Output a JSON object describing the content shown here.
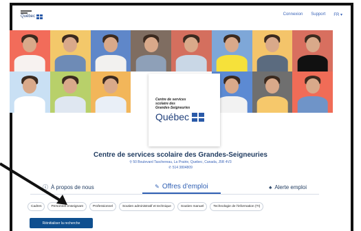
{
  "header": {
    "logo_text": "Québec",
    "links": [
      "Connexion",
      "Support",
      "FR"
    ],
    "colors": {
      "link": "#3a64b8",
      "brand": "#1f3f7a"
    }
  },
  "banner": {
    "tiles": [
      {
        "bg": "#f26c5a",
        "body": "#f7f2f0"
      },
      {
        "bg": "#f3c86a",
        "body": "#6e8bb6"
      },
      {
        "bg": "#5f87c9",
        "body": "#f2f1ef"
      },
      {
        "bg": "#7f6d61",
        "body": "#8ea0b8"
      },
      {
        "bg": "#d46f5e",
        "body": "#c9d7e6"
      },
      {
        "bg": "#7ea7d8",
        "body": "#f6e13a"
      },
      {
        "bg": "#f4c46a",
        "body": "#5b6b7f"
      },
      {
        "bg": "#d86f5f",
        "body": "#111111"
      },
      {
        "bg": "#c9e0f4",
        "body": "#ffffff"
      },
      {
        "bg": "#b8d06a",
        "body": "#dfe7f1"
      },
      {
        "bg": "#f2b65a",
        "body": "#e9eff7"
      },
      {
        "bg": "#ffffff",
        "body": "#ffffff"
      },
      {
        "bg": "#ffffff",
        "body": "#ffffff"
      },
      {
        "bg": "#5c8ad3",
        "body": "#f2f2f2"
      },
      {
        "bg": "#6f6f6f",
        "body": "#f6c86b"
      },
      {
        "bg": "#f06c57",
        "body": "#6f94c8"
      }
    ],
    "card": {
      "line1": "Centre de services",
      "line2": "scolaire des",
      "line3": "Grandes-Seigneuries",
      "quebec": "Québec"
    }
  },
  "org": {
    "name": "Centre de services scolaire des Grandes-Seigneuries",
    "address": "50 Boulevard Taschereau, La Prairie, Quebec, Canada, J5R 4V3",
    "phone": "514 3804809"
  },
  "tabs": {
    "about": "À propos de nous",
    "offers": "Offres d'emploi",
    "alert": "Alerte emploi"
  },
  "chips": [
    "Cadres",
    "Personnel enseignant",
    "Professionnel",
    "Soutien administratif et technique",
    "Soutien manuel",
    "Technologie de l'information (TI)"
  ],
  "reset_button": "Réinitialiser la recherche"
}
